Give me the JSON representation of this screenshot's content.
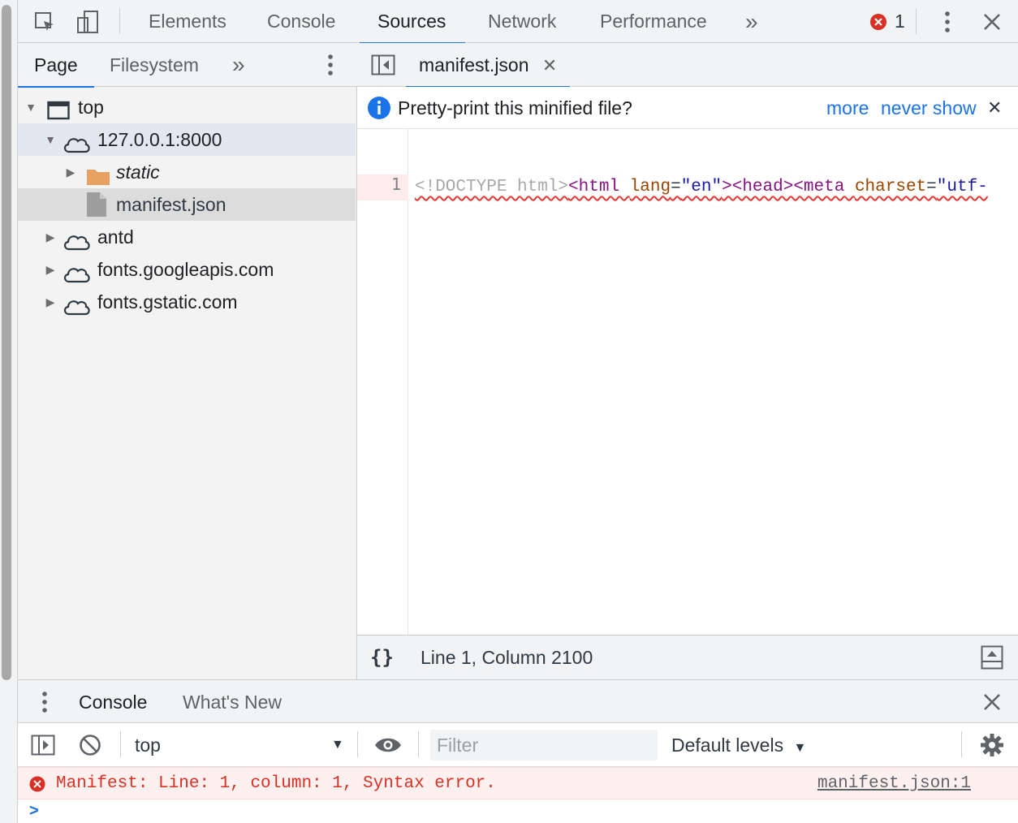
{
  "toolbar": {
    "tabs": [
      "Elements",
      "Console",
      "Sources",
      "Network",
      "Performance"
    ],
    "active_tab": "Sources",
    "more_tabs": "»",
    "error_count": "1"
  },
  "navigator": {
    "tabs": [
      "Page",
      "Filesystem"
    ],
    "active_tab": "Page",
    "more_tabs": "»",
    "tree": [
      {
        "label": "top",
        "icon": "frame-icon",
        "expanded": true
      },
      {
        "label": "127.0.0.1:8000",
        "icon": "cloud-icon",
        "expanded": true
      },
      {
        "label": "static",
        "icon": "folder-icon",
        "expanded": false
      },
      {
        "label": "manifest.json",
        "icon": "file-icon",
        "selected": true
      },
      {
        "label": "antd",
        "icon": "cloud-icon",
        "expanded": false
      },
      {
        "label": "fonts.googleapis.com",
        "icon": "cloud-icon",
        "expanded": false
      },
      {
        "label": "fonts.gstatic.com",
        "icon": "cloud-icon",
        "expanded": false
      }
    ]
  },
  "editor": {
    "file_tab": "manifest.json",
    "infobar": {
      "text": "Pretty-print this minified file?",
      "more_link": "more",
      "never_show_link": "never show"
    },
    "line_number": "1",
    "code": {
      "doctype": "<!DOCTYPE html>",
      "html_open": "<html ",
      "lang_attr": "lang",
      "eq1": "=",
      "lang_val": "\"en\"",
      "head": "><head><meta ",
      "charset_attr": "charset",
      "eq2": "=",
      "charset_val": "\"utf-"
    },
    "status": "Line 1, Column 2100"
  },
  "drawer": {
    "tabs": [
      "Console",
      "What's New"
    ],
    "active_tab": "Console",
    "context": "top",
    "filter_placeholder": "Filter",
    "levels": "Default levels",
    "error_message": "Manifest: Line: 1, column: 1, Syntax error.",
    "error_source": "manifest.json:1",
    "prompt": ">"
  },
  "colors": {
    "accent": "#1a73e8",
    "error": "#d93025",
    "error_bg": "#fff0f0",
    "selected_row": "#dcdcdc",
    "highlight_row": "#e3e8f0",
    "folder": "#e8a161"
  }
}
